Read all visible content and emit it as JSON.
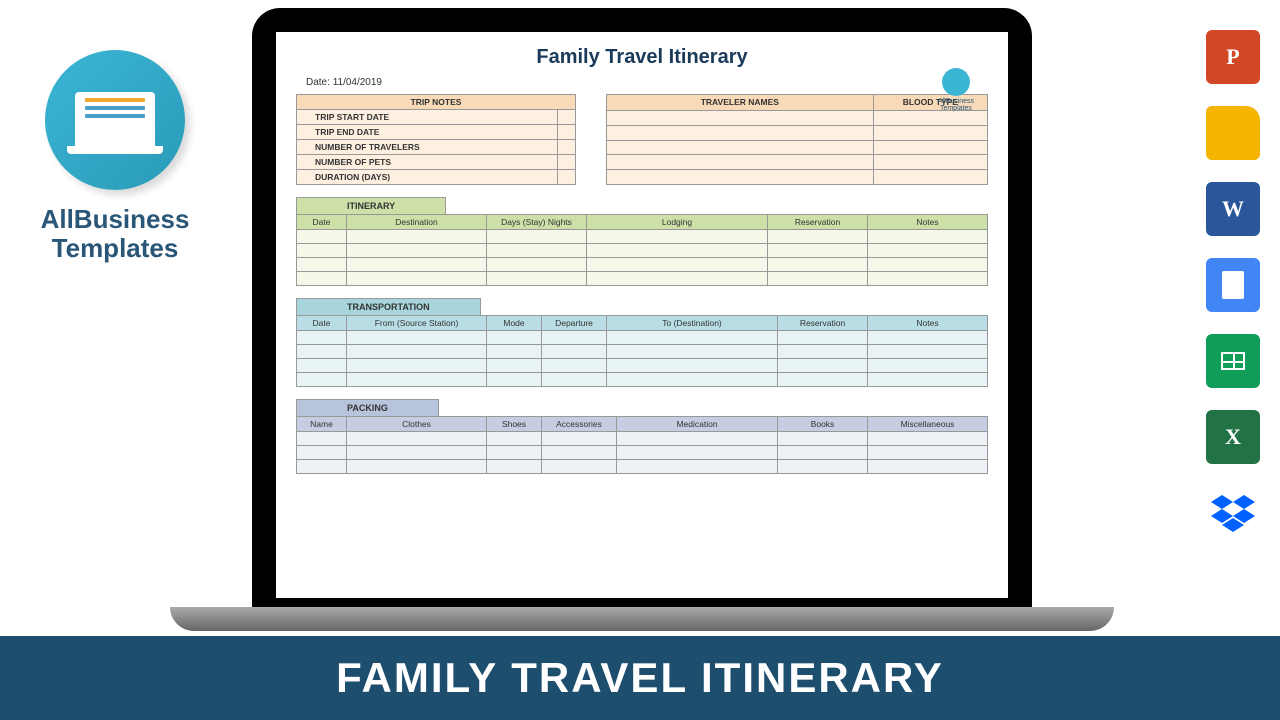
{
  "logo": {
    "line1": "AllBusiness",
    "line2": "Templates"
  },
  "doc": {
    "title": "Family Travel Itinerary",
    "date_label": "Date:",
    "date_value": "11/04/2019",
    "logo_label": "AllBusiness\nTemplates",
    "trip_notes": {
      "header": "TRIP NOTES",
      "rows": [
        "TRIP START DATE",
        "TRIP END DATE",
        "NUMBER OF TRAVELERS",
        "NUMBER OF PETS",
        "DURATION (DAYS)"
      ]
    },
    "travelers": {
      "h1": "TRAVELER NAMES",
      "h2": "BLOOD TYPE"
    },
    "itinerary": {
      "title": "ITINERARY",
      "cols": [
        "Date",
        "Destination",
        "Days (Stay) Nights",
        "Lodging",
        "Reservation",
        "Notes"
      ]
    },
    "transport": {
      "title": "TRANSPORTATION",
      "cols": [
        "Date",
        "From (Source Station)",
        "Mode",
        "Departure",
        "To (Destination)",
        "Reservation",
        "Notes"
      ]
    },
    "packing": {
      "title": "PACKING",
      "cols": [
        "Name",
        "Clothes",
        "Shoes",
        "Accessories",
        "Medication",
        "Books",
        "Miscellaneous"
      ]
    }
  },
  "icons": {
    "ppt": "P",
    "slides": "",
    "word": "W",
    "docs": "",
    "sheets": "",
    "excel": "X",
    "dropbox": "⬡"
  },
  "banner": "FAMILY TRAVEL ITINERARY"
}
